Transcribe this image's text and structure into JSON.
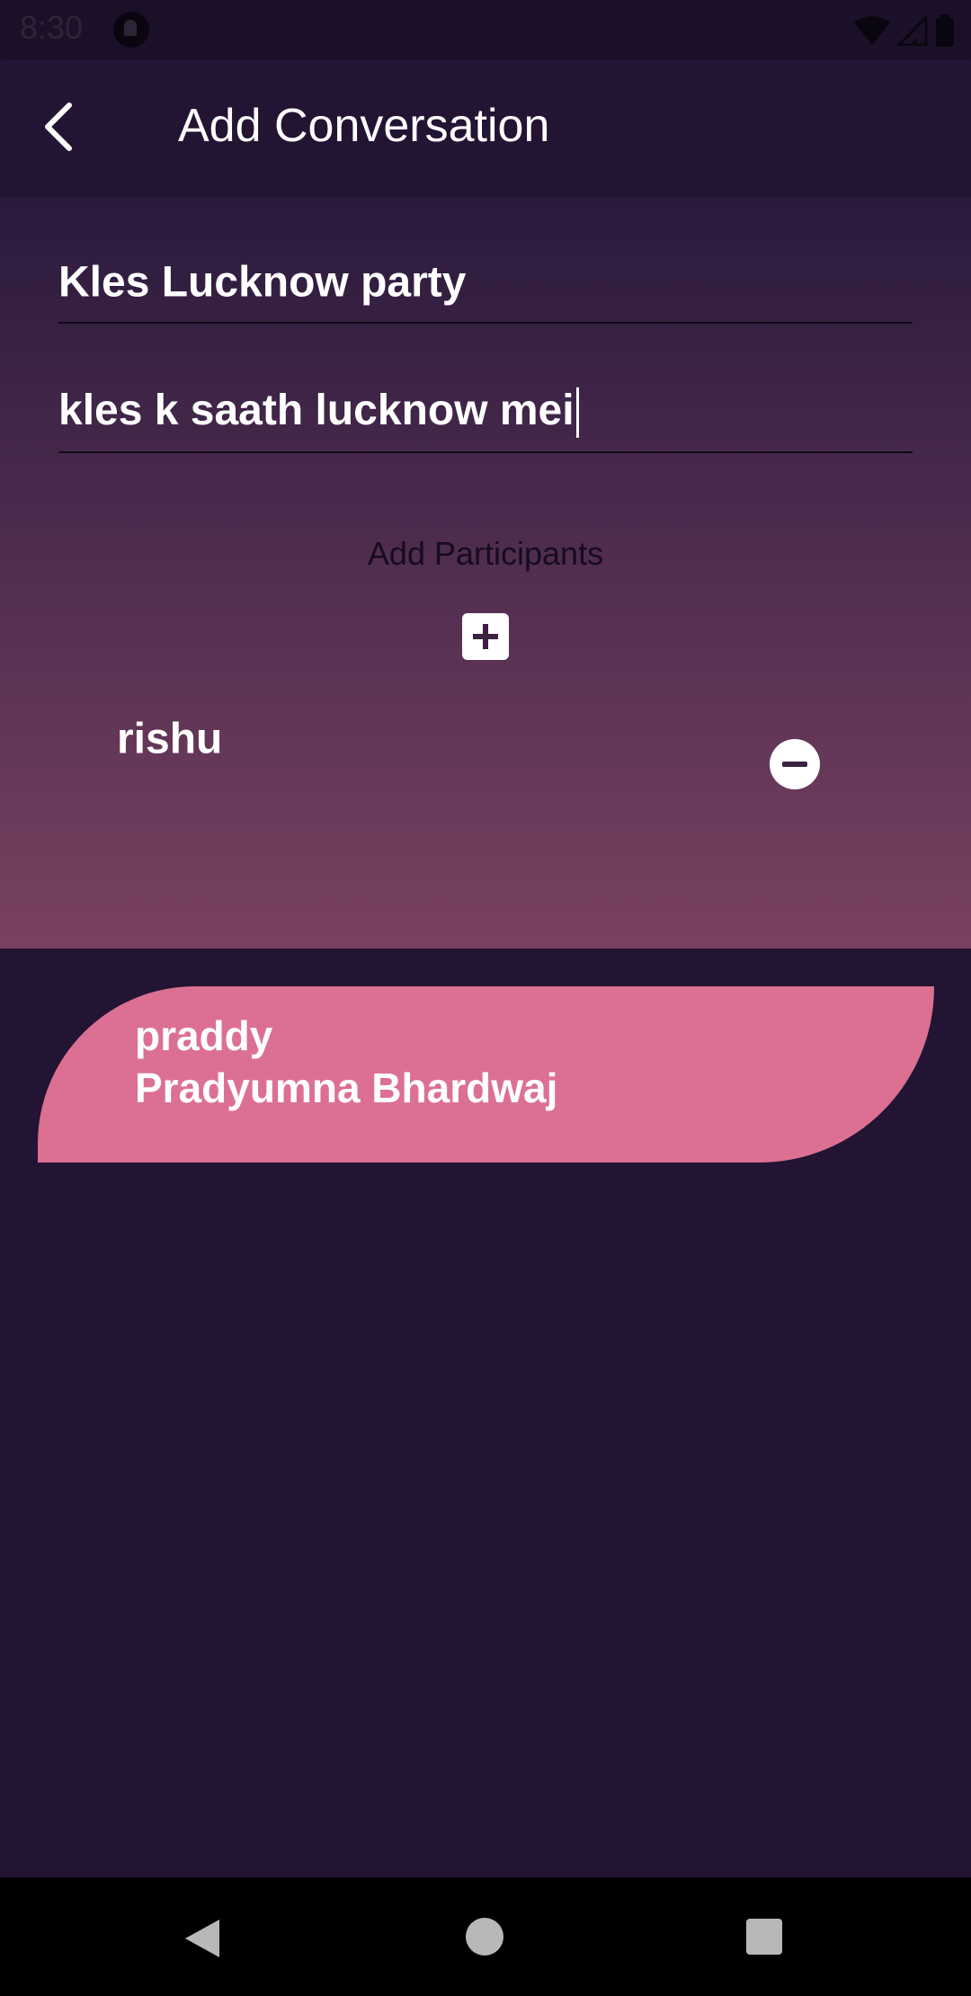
{
  "status_bar": {
    "time": "8:30"
  },
  "app_bar": {
    "title": "Add Conversation"
  },
  "form": {
    "title_value": "Kles Lucknow party",
    "description_value": "kles k saath lucknow mei",
    "participants_label": "Add Participants"
  },
  "participants": [
    {
      "name": "rishu"
    }
  ],
  "contacts": [
    {
      "username": "praddy",
      "full_name": "Pradyumna Bhardwaj"
    }
  ],
  "colors": {
    "background": "#231433",
    "card": "#dc7093",
    "panel_top": "#2a1a3c",
    "panel_bottom": "#7a4160"
  }
}
